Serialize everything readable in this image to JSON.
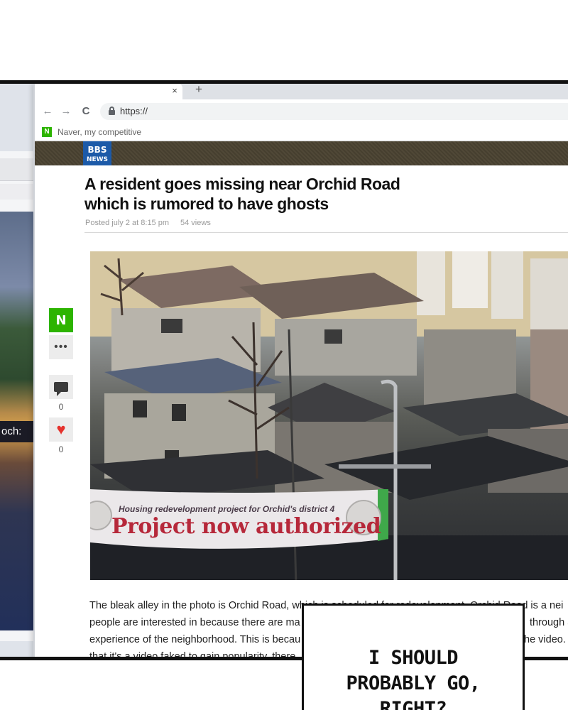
{
  "browser": {
    "tab_close": "×",
    "new_tab": "+",
    "nav": {
      "back": "←",
      "forward": "→",
      "reload": "C"
    },
    "url": "https://",
    "bookmark": {
      "favicon": "N",
      "label": "Naver, my competitive"
    }
  },
  "background_window": {
    "visible_text": "och:"
  },
  "article": {
    "logo": {
      "line1": "BBS",
      "line2": "NEWS"
    },
    "headline_line1": "A resident goes missing near Orchid Road",
    "headline_line2": "which is rumored to have ghosts",
    "posted": "Posted july 2 at 8:15 pm",
    "views": "54 views",
    "photo_banner_small": "Housing redevelopment project for Orchid's district 4",
    "photo_banner_big": "Project now authorized",
    "body": [
      "The bleak alley in the photo is Orchid Road, which is scheduled for redevelopment. Orchid Road is a nei",
      "people are interested in because there are ma",
      "experience of the neighborhood. This is becau",
      "that it's a video faked to gain popularity, there"
    ],
    "body_right": [
      "",
      "through a",
      "he video. A",
      ""
    ]
  },
  "side_actions": {
    "naver_label": "N",
    "more_label": "•••",
    "comment_count": "0",
    "like_icon": "♥",
    "like_count": "0"
  },
  "speech_bubble": {
    "line1": "I SHOULD",
    "line2": "PROBABLY GO,",
    "line3": "RIGHT?"
  },
  "colors": {
    "naver_green": "#2db400",
    "header_band": "#4a4231",
    "bbs_blue": "#1c5aa8",
    "banner_red": "#b6283a",
    "like_red": "#e5322d"
  }
}
